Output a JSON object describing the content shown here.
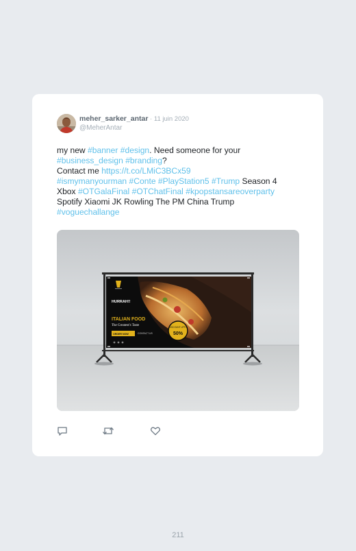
{
  "tweet": {
    "display_name": "meher_sarker_antar",
    "date_separator": " · ",
    "date": "11 juin 2020",
    "handle": "@MeherAntar",
    "text": {
      "t1": "my new ",
      "tag_banner": "#banner",
      "sp1": " ",
      "tag_design": "#design",
      "t2": ". Need someone for your",
      "tag_business_design": "#business_design",
      "sp2": " ",
      "tag_branding": "#branding",
      "t3": "?",
      "t4": "Contact me ",
      "link": "https://t.co/LMiC3BCx59",
      "tag_ismymanyourman": "#ismymanyourman",
      "sp3": " ",
      "tag_conte": "#Conte",
      "sp4": " ",
      "tag_playstation5": "#PlayStation5",
      "sp5": " ",
      "tag_trump": "#Trump",
      "t5": " Season 4",
      "t6": "Xbox ",
      "tag_otgalafinal": "#OTGalaFinal",
      "sp6": " ",
      "tag_otchatfinal": "#OTChatFinal",
      "sp7": " ",
      "tag_kpopstans": "#kpopstansareoverparty",
      "t7": "Spotify Xiaomi JK Rowling The PM China Trump",
      "tag_voguechallange": "#voguechallange"
    },
    "media": {
      "banner": {
        "hurrah": "HURRAH!!",
        "title": "ITALIAN FOOD",
        "subtitle": "The Greatest's Taste",
        "order_button": "ORDER NOW",
        "contact": "CONTACT US",
        "discount_label": "DISCOUNT UPTO",
        "discount_value": "50%"
      }
    },
    "actions": {
      "reply_icon": "reply-icon",
      "retweet_icon": "retweet-icon",
      "like_icon": "heart-icon"
    }
  },
  "page": {
    "number": "211"
  },
  "colors": {
    "background": "#e8ebef",
    "card": "#ffffff",
    "hashtag": "#5fc0ea",
    "text": "#1b1f23",
    "muted": "#a3adb6"
  }
}
